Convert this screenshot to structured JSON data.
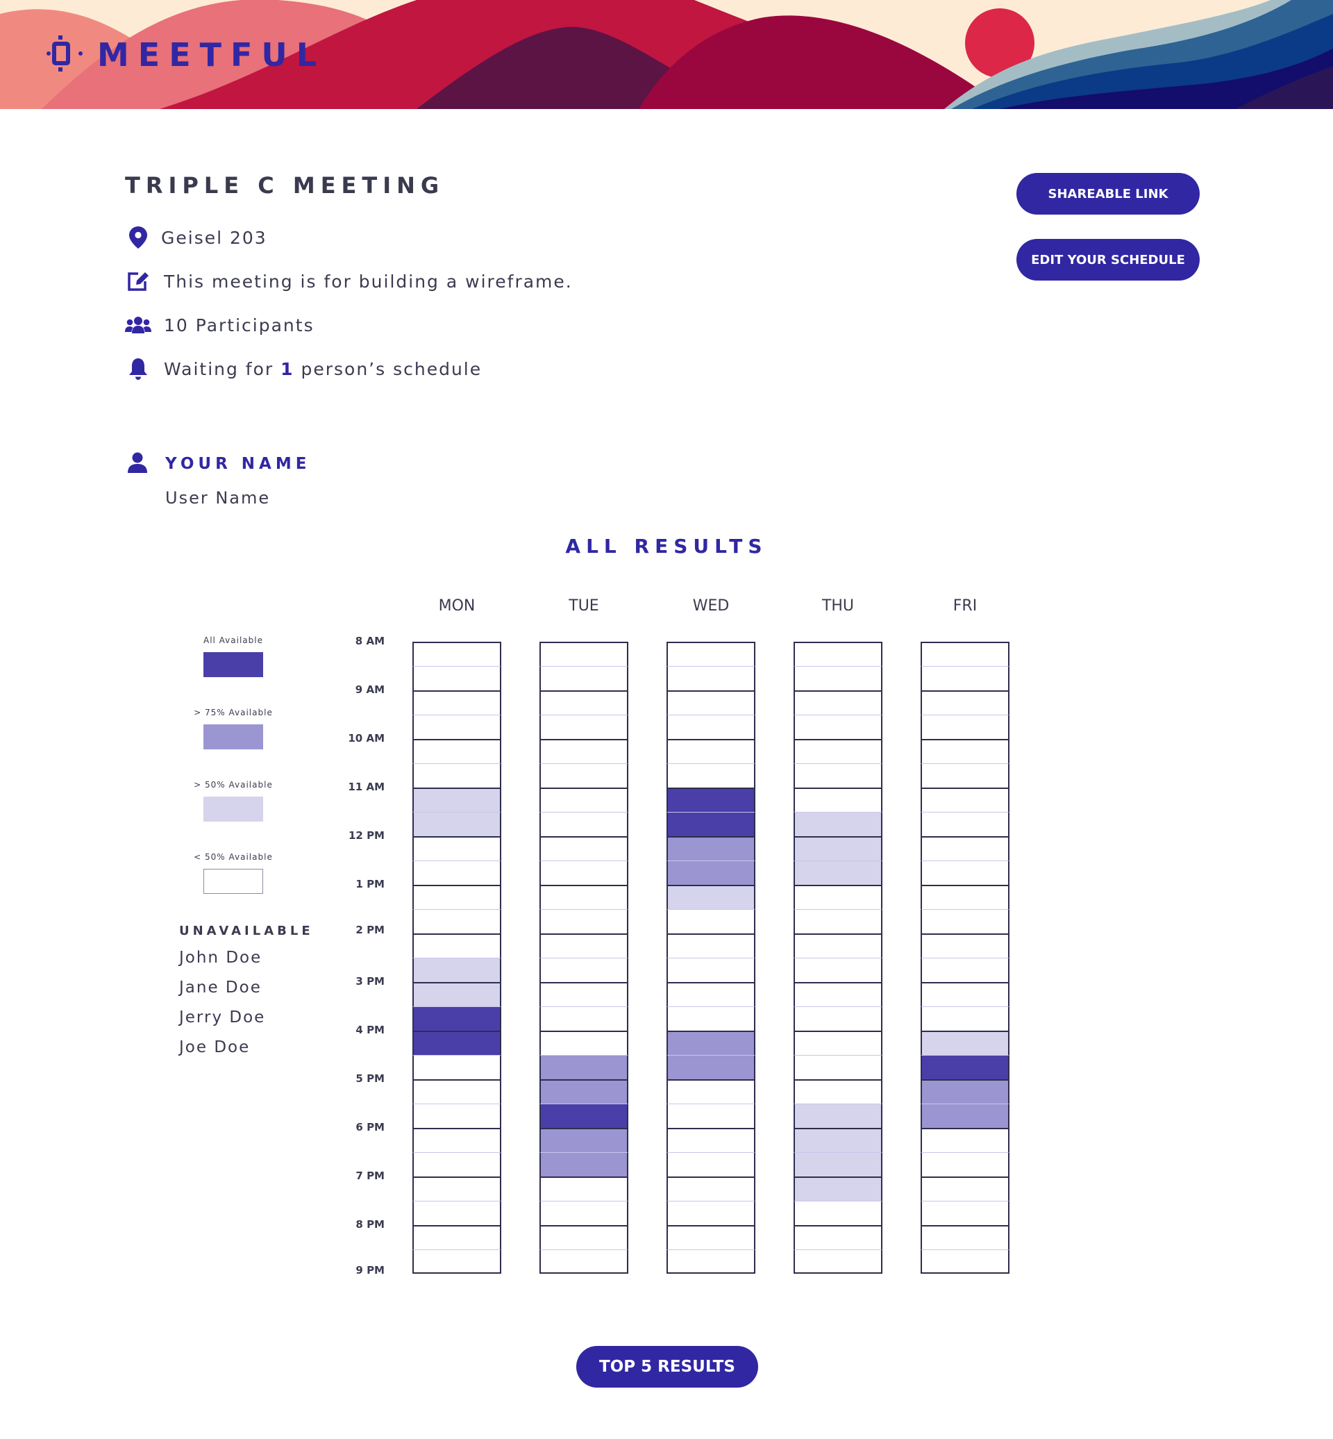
{
  "app": {
    "name": "MEETFUL"
  },
  "meeting": {
    "title": "TRIPLE C MEETING",
    "location": "Geisel 203",
    "description": "This meeting is for building a wireframe.",
    "participants": "10 Participants",
    "waiting_prefix": "Waiting for ",
    "waiting_count": "1",
    "waiting_suffix": " person’s schedule"
  },
  "buttons": {
    "shareable_link": "SHAREABLE LINK",
    "edit_schedule": "EDIT YOUR SCHEDULE",
    "top5": "TOP 5 RESULTS"
  },
  "user": {
    "label": "YOUR NAME",
    "name": "User Name"
  },
  "results": {
    "heading": "ALL RESULTS"
  },
  "legend": [
    {
      "label": "All Available",
      "level": 3,
      "color": "#4a3fa8"
    },
    {
      "label": "> 75% Available",
      "level": 2,
      "color": "#9b95d2"
    },
    {
      "label": "> 50% Available",
      "level": 1,
      "color": "#d6d3ec"
    },
    {
      "label": "< 50% Available",
      "level": 0,
      "color": "#ffffff"
    }
  ],
  "unavailable": {
    "title": "UNAVAILABLE",
    "names": [
      "John Doe",
      "Jane Doe",
      "Jerry Doe",
      "Joe Doe"
    ]
  },
  "schedule": {
    "days": [
      "MON",
      "TUE",
      "WED",
      "THU",
      "FRI"
    ],
    "times": [
      "8 AM",
      "9 AM",
      "10 AM",
      "11 AM",
      "12 PM",
      "1 PM",
      "2 PM",
      "3 PM",
      "4 PM",
      "5 PM",
      "6 PM",
      "7 PM",
      "8 PM",
      "9 PM"
    ],
    "slot_minutes": 30,
    "availability": {
      "MON": [
        0,
        0,
        0,
        0,
        0,
        0,
        1,
        1,
        0,
        0,
        0,
        0,
        0,
        1,
        1,
        3,
        3,
        0,
        0,
        0,
        0,
        0,
        0,
        0,
        0,
        0
      ],
      "TUE": [
        0,
        0,
        0,
        0,
        0,
        0,
        0,
        0,
        0,
        0,
        0,
        0,
        0,
        0,
        0,
        0,
        0,
        2,
        2,
        3,
        2,
        2,
        0,
        0,
        0,
        0
      ],
      "WED": [
        0,
        0,
        0,
        0,
        0,
        0,
        3,
        3,
        2,
        2,
        1,
        0,
        0,
        0,
        0,
        0,
        2,
        2,
        0,
        0,
        0,
        0,
        0,
        0,
        0,
        0
      ],
      "THU": [
        0,
        0,
        0,
        0,
        0,
        0,
        0,
        1,
        1,
        1,
        0,
        0,
        0,
        0,
        0,
        0,
        0,
        0,
        0,
        1,
        1,
        1,
        1,
        0,
        0,
        0
      ],
      "FRI": [
        0,
        0,
        0,
        0,
        0,
        0,
        0,
        0,
        0,
        0,
        0,
        0,
        0,
        0,
        0,
        0,
        1,
        3,
        2,
        2,
        0,
        0,
        0,
        0,
        0,
        0
      ]
    }
  },
  "colors": {
    "primary": "#3127a3",
    "level_3": "#4a3fa8",
    "level_2": "#9b95d2",
    "level_1": "#d6d3ec",
    "level_0": "#ffffff"
  }
}
